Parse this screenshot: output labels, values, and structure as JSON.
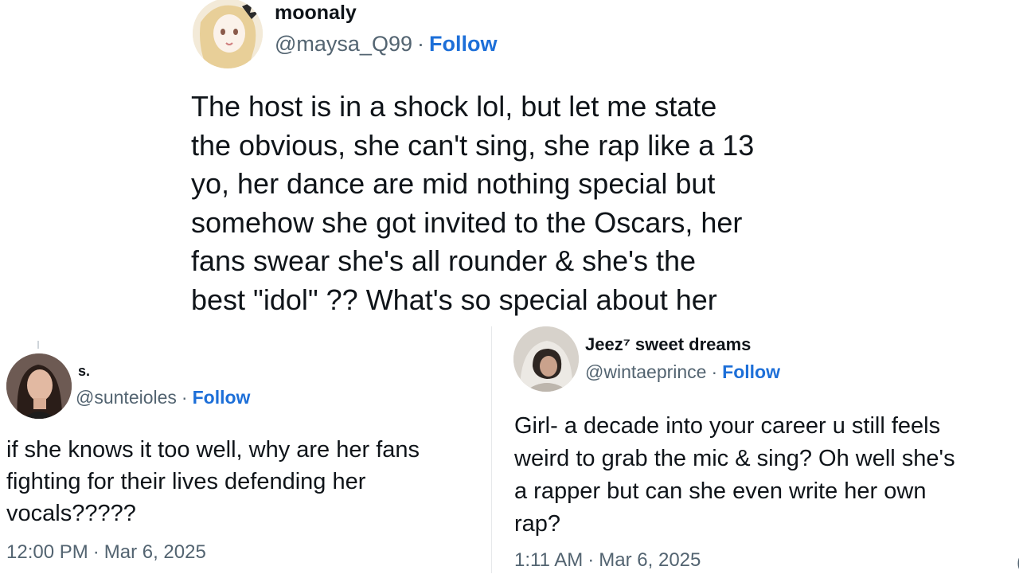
{
  "tweets": [
    {
      "name": "moonaly",
      "handle": "@maysa_Q99",
      "follow_label": "Follow",
      "separator": "·",
      "text": "The host is in a shock lol, but let me state\nthe obvious, she can't sing, she rap like a 13\nyo, her dance are mid nothing special but\nsomehow she got invited to the Oscars, her\nfans swear she's all rounder & she's the\nbest \"idol\" ?? What's so special about her",
      "avatar_icon": "anime-girl-avatar-icon"
    },
    {
      "name": "s.",
      "handle": "@sunteioles",
      "follow_label": "Follow",
      "separator": "·",
      "text": "if she knows it too well, why are her fans\nfighting for their lives defending her\nvocals?????",
      "time": "12:00 PM",
      "date": "Mar 6, 2025",
      "avatar_icon": "woman-portrait-avatar-icon"
    },
    {
      "name": "Jeez⁷ sweet dreams",
      "handle": "@wintaeprince",
      "follow_label": "Follow",
      "separator": "·",
      "text": "Girl- a decade into your career u still feels\nweird to grab the mic & sing? Oh well she's\na rapper but can she even write her own\nrap?",
      "time": "1:11 AM",
      "date": "Mar 6, 2025",
      "avatar_icon": "person-hoodie-avatar-icon"
    }
  ],
  "colors": {
    "link": "#1d6fd8",
    "text": "#0f1419",
    "muted": "#536471"
  }
}
